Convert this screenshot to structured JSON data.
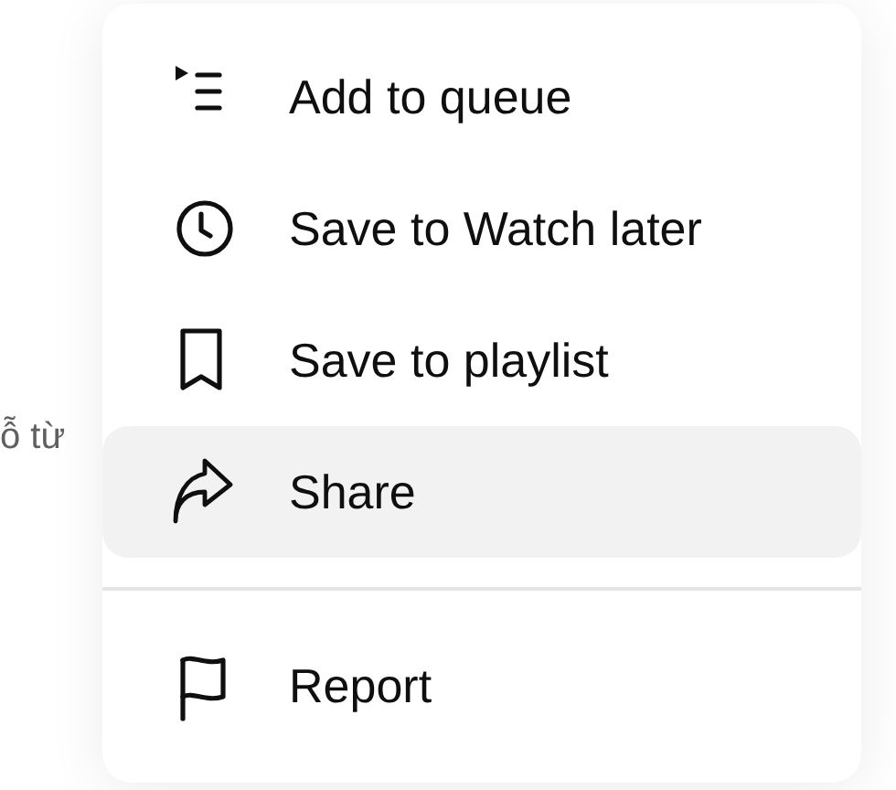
{
  "background_text": "ỗ từ",
  "menu": {
    "groups": [
      {
        "items": [
          {
            "label": "Add to queue",
            "selected": false
          },
          {
            "label": "Save to Watch later",
            "selected": false
          },
          {
            "label": "Save to playlist",
            "selected": false
          },
          {
            "label": "Share",
            "selected": true
          }
        ]
      },
      {
        "items": [
          {
            "label": "Report",
            "selected": false
          }
        ]
      }
    ]
  }
}
